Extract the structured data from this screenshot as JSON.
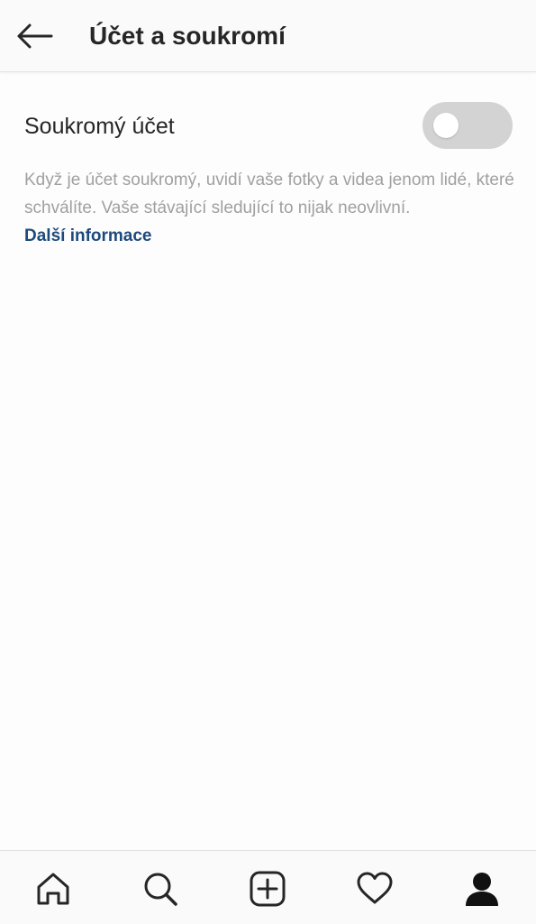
{
  "header": {
    "title": "Účet a soukromí",
    "back_icon": "arrow-left-icon"
  },
  "private_account": {
    "label": "Soukromý účet",
    "enabled": false,
    "description": "Když je účet soukromý, uvidí vaše fotky a videa jenom lidé, které schválíte. Vaše stávající sledující to nijak neovlivní.",
    "learn_more": "Další informace"
  },
  "bottom_nav": {
    "items": [
      {
        "icon": "home-icon"
      },
      {
        "icon": "search-icon"
      },
      {
        "icon": "add-post-icon"
      },
      {
        "icon": "heart-icon"
      },
      {
        "icon": "profile-icon"
      }
    ]
  },
  "colors": {
    "link": "#1d4a7c",
    "text": "#262626",
    "muted": "#a0a0a0",
    "toggle_off": "#d3d3d3"
  }
}
